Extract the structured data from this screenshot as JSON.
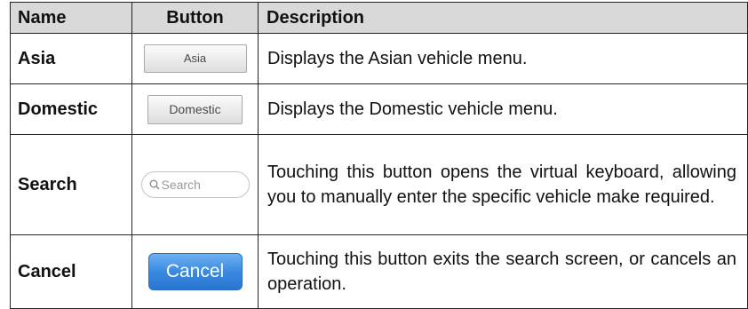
{
  "table": {
    "headers": {
      "name": "Name",
      "button": "Button",
      "description": "Description"
    },
    "rows": [
      {
        "name": "Asia",
        "button_label": "Asia",
        "description": "Displays the Asian vehicle menu."
      },
      {
        "name": "Domestic",
        "button_label": "Domestic",
        "description": "Displays the Domestic vehicle menu."
      },
      {
        "name": "Search",
        "button_label": "Search",
        "search_icon": "magnifier-icon",
        "description": "Touching this button opens the virtual keyboard, allowing you to manually enter the specific vehicle make required."
      },
      {
        "name": "Cancel",
        "button_label": "Cancel",
        "description": "Touching this button exits the search screen, or cancels an operation."
      }
    ]
  },
  "colors": {
    "header_bg": "#d9d9d9",
    "cancel_button": "#3a8ae0",
    "border": "#222222"
  }
}
